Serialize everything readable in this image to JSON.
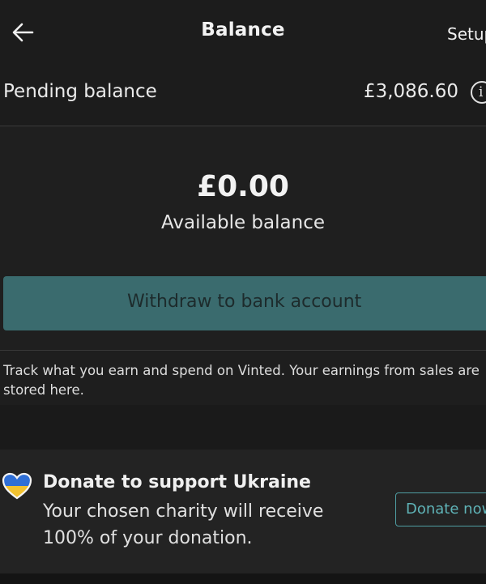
{
  "header": {
    "title": "Balance",
    "setup_label": "Setup",
    "back_icon": "arrow-left-icon"
  },
  "pending": {
    "label": "Pending balance",
    "amount": "£3,086.60",
    "info_glyph": "i"
  },
  "available": {
    "amount": "£0.00",
    "label": "Available balance",
    "withdraw_label": "Withdraw to bank account"
  },
  "info": {
    "text": "Track what you earn and spend on Vinted. Your earnings from sales are stored here."
  },
  "donate": {
    "icon": "ukraine-heart-icon",
    "title": "Donate to support Ukraine",
    "description": "Your chosen charity will receive 100% of your donation.",
    "button_label": "Donate now"
  },
  "colors": {
    "background": "#1e1e1e",
    "accent": "#3a6b6e",
    "accent_text": "#5fb3b7",
    "heart_blue": "#2f6fd6",
    "heart_yellow": "#f2c230"
  }
}
